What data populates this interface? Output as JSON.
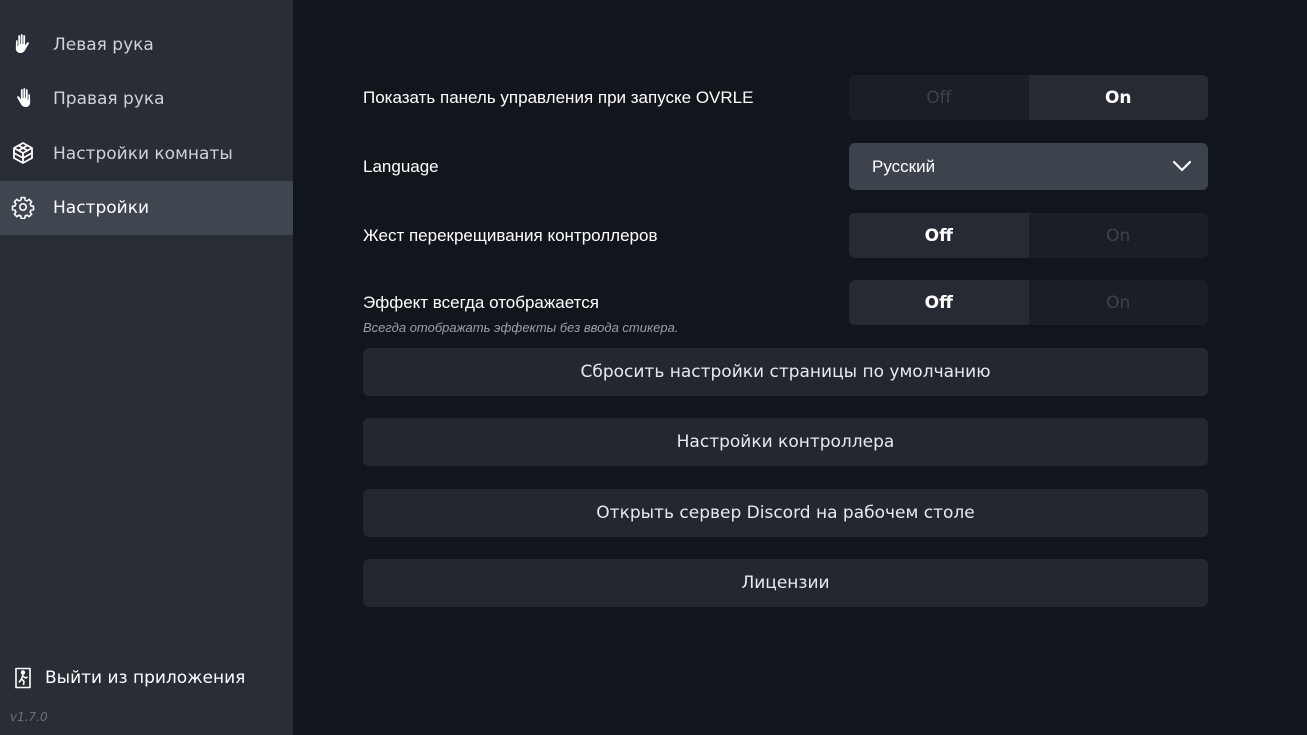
{
  "sidebar": {
    "items": [
      {
        "label": "Левая рука",
        "icon": "left-hand-icon"
      },
      {
        "label": "Правая рука",
        "icon": "right-hand-icon"
      },
      {
        "label": "Настройки комнаты",
        "icon": "room-icon"
      },
      {
        "label": "Настройки",
        "icon": "gear-icon",
        "active": true
      }
    ],
    "exit_label": "Выйти из приложения",
    "version": "v1.7.0"
  },
  "settings": {
    "show_panel": {
      "label": "Показать панель управления при запуске OVRLE",
      "off": "Off",
      "on": "On",
      "value": "On"
    },
    "language": {
      "label": "Language",
      "value": "Русский"
    },
    "cross_gesture": {
      "label": "Жест перекрещивания контроллеров",
      "off": "Off",
      "on": "On",
      "value": "Off"
    },
    "effect_always": {
      "label": "Эффект всегда отображается",
      "sublabel": "Всегда отображать эффекты без ввода стикера.",
      "off": "Off",
      "on": "On",
      "value": "Off"
    }
  },
  "buttons": {
    "reset": "Сбросить настройки страницы по умолчанию",
    "controller": "Настройки контроллера",
    "discord": "Открыть сервер Discord на рабочем столе",
    "licenses": "Лицензии"
  },
  "colors": {
    "sidebar_bg": "#282d36",
    "active_bg": "#3f4650",
    "main_bg": "#11161d",
    "button_bg": "#232830"
  }
}
